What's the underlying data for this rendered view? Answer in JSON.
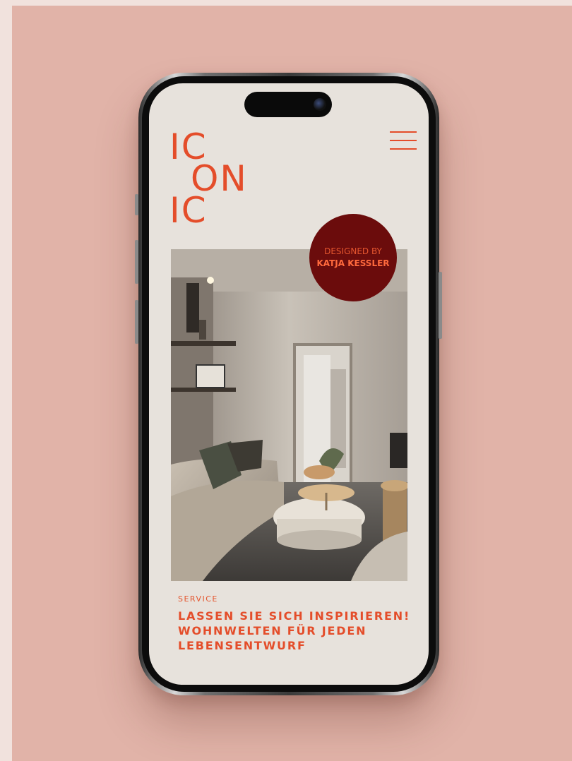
{
  "brand": {
    "logo_lines": [
      "IC",
      "ON",
      "IC"
    ],
    "accent_color": "#e44d2a"
  },
  "header": {
    "menu_icon": "hamburger-menu-icon"
  },
  "badge": {
    "line1": "DESIGNED BY",
    "line2": "KATJA KESSLER",
    "color": "#6b0c0c"
  },
  "section": {
    "eyebrow": "SERVICE",
    "headline_lines": [
      "LASSEN SIE SICH INSPIRIEREN!",
      "WOHNWELTEN FÜR JEDEN",
      "LEBENSENTWURF"
    ]
  }
}
